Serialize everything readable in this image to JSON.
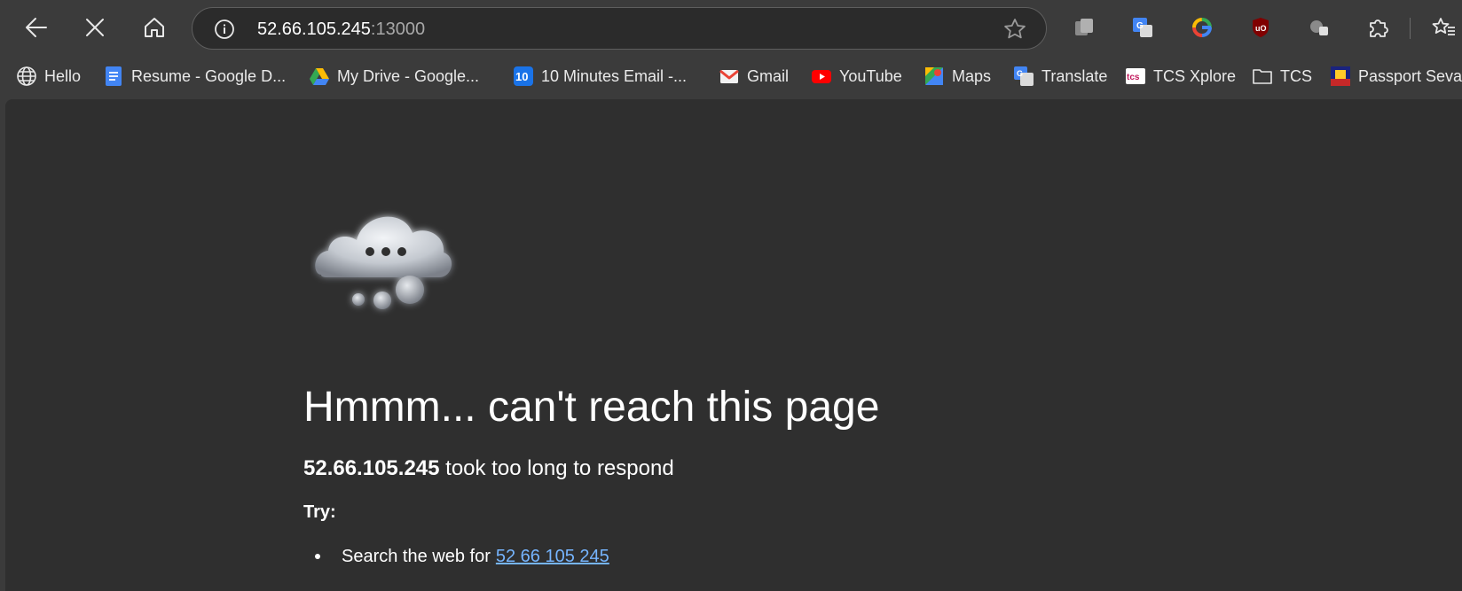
{
  "address_bar": {
    "host": "52.66.105.245",
    "port": ":13000"
  },
  "favorites": [
    {
      "label": "Hello",
      "icon": "globe-icon"
    },
    {
      "label": "Resume - Google D...",
      "icon": "google-docs-icon"
    },
    {
      "label": "My Drive - Google...",
      "icon": "google-drive-icon"
    },
    {
      "label": "10 Minutes Email -...",
      "icon": "ten-minute-email-icon"
    },
    {
      "label": "Gmail",
      "icon": "gmail-icon"
    },
    {
      "label": "YouTube",
      "icon": "youtube-icon"
    },
    {
      "label": "Maps",
      "icon": "google-maps-icon"
    },
    {
      "label": "Translate",
      "icon": "google-translate-icon"
    },
    {
      "label": "TCS Xplore",
      "icon": "tcs-icon"
    },
    {
      "label": "TCS",
      "icon": "folder-icon"
    },
    {
      "label": "Passport Seva",
      "icon": "passport-seva-icon"
    }
  ],
  "extensions": [
    "collections-icon",
    "google-translate-icon",
    "google-icon",
    "ublock-icon",
    "profile-switch-icon",
    "extensions-puzzle-icon",
    "favorites-icon"
  ],
  "error": {
    "title": "Hmmm... can't reach this page",
    "host": "52.66.105.245",
    "subtitle_rest": " took too long to respond",
    "try_label": "Try:",
    "suggestion_prefix": "Search the web for",
    "suggestion_link": "52 66 105 245"
  },
  "colors": {
    "toolbar_bg": "#3b3b3b",
    "content_bg": "#2f2f2f",
    "link": "#76b5ff"
  }
}
